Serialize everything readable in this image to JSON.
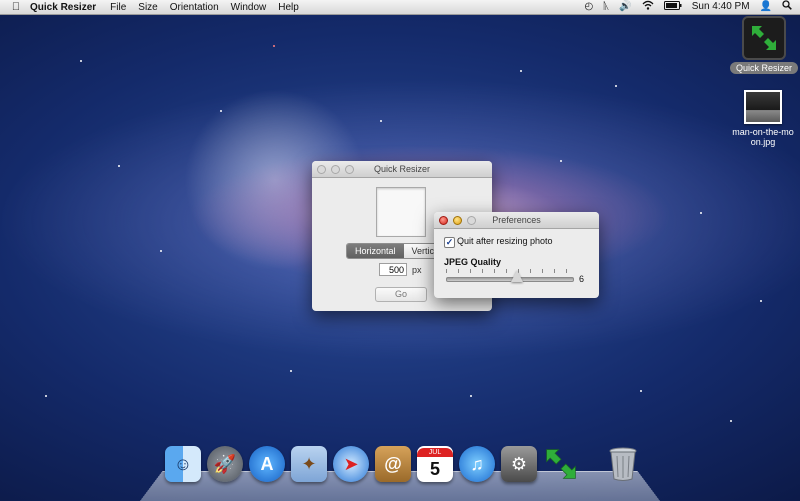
{
  "menubar": {
    "apple_icon": "apple-logo-icon",
    "app_name": "Quick Resizer",
    "items": [
      "File",
      "Size",
      "Orientation",
      "Window",
      "Help"
    ],
    "clock": "Sun 4:40 PM",
    "status_icons": [
      "time-machine-icon",
      "bluetooth-icon",
      "volume-icon",
      "wifi-icon",
      "battery-icon",
      "user-icon",
      "spotlight-icon"
    ]
  },
  "desktop": {
    "icons": [
      {
        "label": "Quick Resizer",
        "icon": "quick-resizer-app-icon"
      },
      {
        "label": "man-on-the-moon.jpg",
        "icon": "image-file-icon"
      }
    ]
  },
  "quick_resizer_window": {
    "title": "Quick Resizer",
    "segments": [
      "Horizontal",
      "Vertical"
    ],
    "selected_segment": "Horizontal",
    "size_value": "500",
    "size_unit": "px",
    "go_label": "Go"
  },
  "preferences_window": {
    "title": "Preferences",
    "checkbox_label": "Quit after resizing photo",
    "checkbox_checked": true,
    "quality_label": "JPEG Quality",
    "quality_value": "6",
    "quality_min": 0,
    "quality_max": 10
  },
  "dock": {
    "items": [
      "finder-icon",
      "launchpad-icon",
      "app-store-icon",
      "mail-icon",
      "safari-icon",
      "address-book-icon",
      "calendar-icon",
      "itunes-icon",
      "system-preferences-icon",
      "quick-resizer-dock-icon",
      "trash-icon"
    ],
    "calendar_day": "5",
    "calendar_month": "JUL"
  },
  "colors": {
    "selected_segment": "#6e6e6e",
    "close_button": "#d2231a",
    "minimize_button": "#e0a012",
    "zoom_button": "#3e9d22",
    "quick_resizer_green": "#2fae3a"
  }
}
